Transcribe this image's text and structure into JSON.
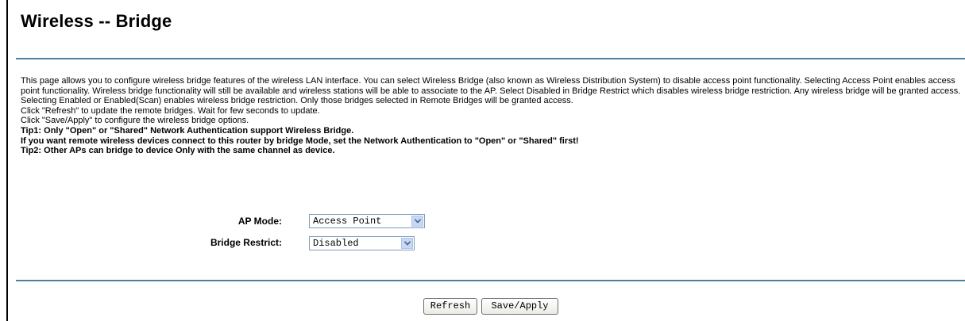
{
  "page": {
    "title": "Wireless -- Bridge"
  },
  "description": {
    "paragraph": "This page allows you to configure wireless bridge features of the wireless LAN interface. You can select Wireless Bridge (also known as Wireless Distribution System) to disable access point functionality. Selecting Access Point enables access point functionality. Wireless bridge functionality will still be available and wireless stations will be able to associate to the AP. Select Disabled in Bridge Restrict which disables wireless bridge restriction. Any wireless bridge will be granted access. Selecting Enabled or Enabled(Scan) enables wireless bridge restriction. Only those bridges selected in Remote Bridges will be granted access.",
    "refresh_line": "Click \"Refresh\" to update the remote bridges. Wait for few seconds to update.",
    "save_line": "Click \"Save/Apply\" to configure the wireless bridge options.",
    "tip1": "Tip1: Only \"Open\" or \"Shared\" Network Authentication support Wireless Bridge.",
    "tip1b": "If you want remote wireless devices connect to this router by bridge Mode, set the Network Authentication to \"Open\" or \"Shared\" first!",
    "tip2": "Tip2: Other APs can bridge to device Only with the same channel as device."
  },
  "form": {
    "ap_mode": {
      "label": "AP Mode:",
      "value": "Access Point"
    },
    "bridge_restrict": {
      "label": "Bridge Restrict:",
      "value": "Disabled"
    }
  },
  "buttons": {
    "refresh": "Refresh",
    "save_apply": "Save/Apply"
  },
  "colors": {
    "rule": "#4d7fa3",
    "dropdown_arrow_bg": "#c7d7f5"
  },
  "icons": {
    "dropdown": "chevron-down-icon"
  }
}
